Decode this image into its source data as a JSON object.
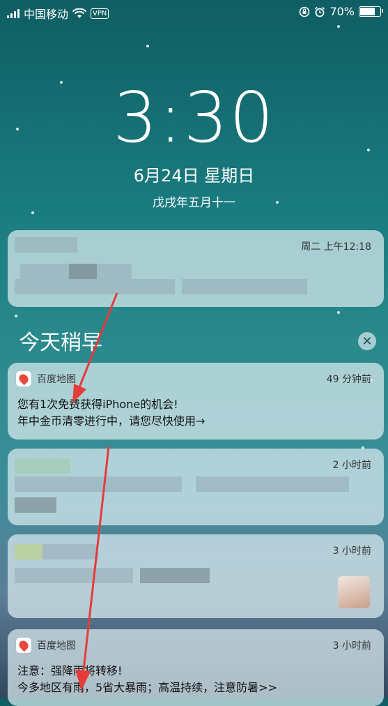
{
  "status_bar": {
    "carrier": "中国移动",
    "vpn": "VPN",
    "battery": "70%"
  },
  "lock": {
    "time": "3:30",
    "date": "6月24日 星期日",
    "lunar": "戊戌年五月十一"
  },
  "notif_top": {
    "timestamp": "周二 上午12:18"
  },
  "section": {
    "title": "今天稍早"
  },
  "notif1": {
    "app": "百度地图",
    "timestamp": "49 分钟前",
    "line1": "您有1次免费获得iPhone的机会!",
    "line2": "年中金币清零进行中，请您尽快使用→"
  },
  "notif2": {
    "timestamp": "2 小时前"
  },
  "notif3": {
    "timestamp": "3 小时前"
  },
  "notif4": {
    "app": "百度地图",
    "timestamp": "3 小时前",
    "line1": "注意：强降雨将转移!",
    "line2": "今多地区有雨，5省大暴雨；高温持续，注意防暑>>"
  },
  "icons": {
    "wifi": "wifi-icon",
    "lock": "rotation-lock-icon",
    "alarm": "alarm-icon",
    "close": "close-icon"
  }
}
